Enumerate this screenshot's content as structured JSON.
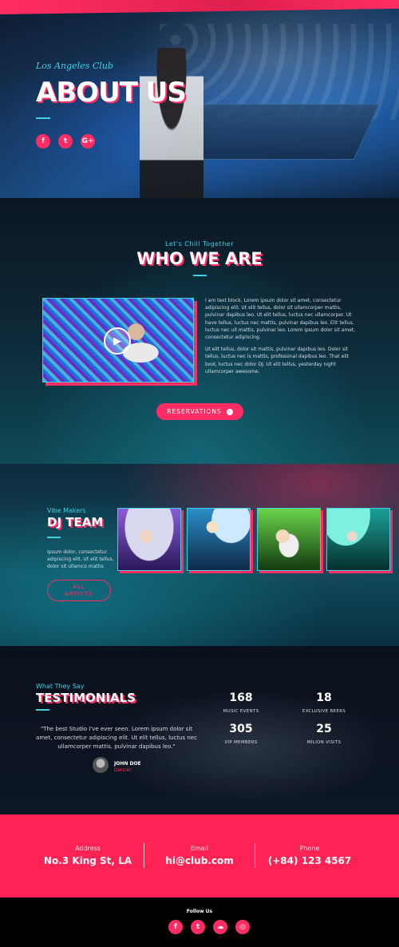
{
  "hero": {
    "subtitle": "Los Angeles Club",
    "title": "ABOUT US",
    "social": [
      {
        "icon": "facebook-icon",
        "glyph": "f"
      },
      {
        "icon": "twitter-icon",
        "glyph": "t"
      },
      {
        "icon": "google-plus-icon",
        "glyph": "G+"
      }
    ]
  },
  "who": {
    "eyebrow": "Let's Chill Together",
    "title": "WHO WE ARE",
    "paragraph1": "I am text block. Lorem ipsum dolor sit amet, consectetur adipiscing elit. Ut elit tellus, dolor sit ullamcorper mattis, pulvinar dapibus leo. Ut elit tellus, luctus nec ullamcorper. Ut have tellus, luctus nec mattis, pulvinar dapibus leo. Elit tellus, luctus nec ull mattis, pulvinar leo. Lorem ipsum dolor sit amet, consectetur adipiscing.",
    "paragraph2": "Ut elit tellus, dolor sit mattis, pulvinar dapibus leo. Dolor sit tellus, luctus nec is mattis, professinal dapibus leo. That elit bool, luctus nec dolor DJ. Ut elit tellus, yesterday night ullamcorper awesome.",
    "button_label": "RESERVATIONS",
    "button_arrow": "›"
  },
  "team": {
    "eyebrow": "Vibe Makers",
    "title": "DJ TEAM",
    "description": "Ipsum dolor, consectetur adipiscing elit. Ut elit tellus, dolor sit ullamco mattis",
    "button_line1": "ALL",
    "button_line2": "ARTISTS"
  },
  "testimonials": {
    "eyebrow": "What They Say",
    "title": "TESTIMONIALS",
    "quote": "\"The best Studio I've ever seen. Lorem ipsum dolor sit amet, consectetur adipiscing elit. Ut elit tellus, luctus nec ullamcorper mattis, pulvinar dapibus leo.\"",
    "author_name": "JOHN DOE",
    "author_role": "Dancer",
    "stats": [
      {
        "value": "168",
        "label": "MUSIC EVENTS"
      },
      {
        "value": "18",
        "label": "EXCLUSIVE BEERS"
      },
      {
        "value": "305",
        "label": "VIP MEMBERS"
      },
      {
        "value": "25",
        "label": "MILION VISITS"
      }
    ]
  },
  "contact": {
    "address_label": "Address",
    "address_value": "No.3 King St, LA",
    "email_label": "Email",
    "email_value": "hi@club.com",
    "phone_label": "Phone",
    "phone_value": "(+84) 123 4567"
  },
  "footer": {
    "follow_label": "Follow Us",
    "social": [
      {
        "icon": "facebook-icon",
        "glyph": "f"
      },
      {
        "icon": "twitter-icon",
        "glyph": "t"
      },
      {
        "icon": "soundcloud-icon",
        "glyph": "☁"
      },
      {
        "icon": "instagram-icon",
        "glyph": "◎"
      }
    ]
  },
  "colors": {
    "accent": "#ff2d63",
    "cyan": "#3fd0e6",
    "contact_bg": "#ff2255"
  }
}
